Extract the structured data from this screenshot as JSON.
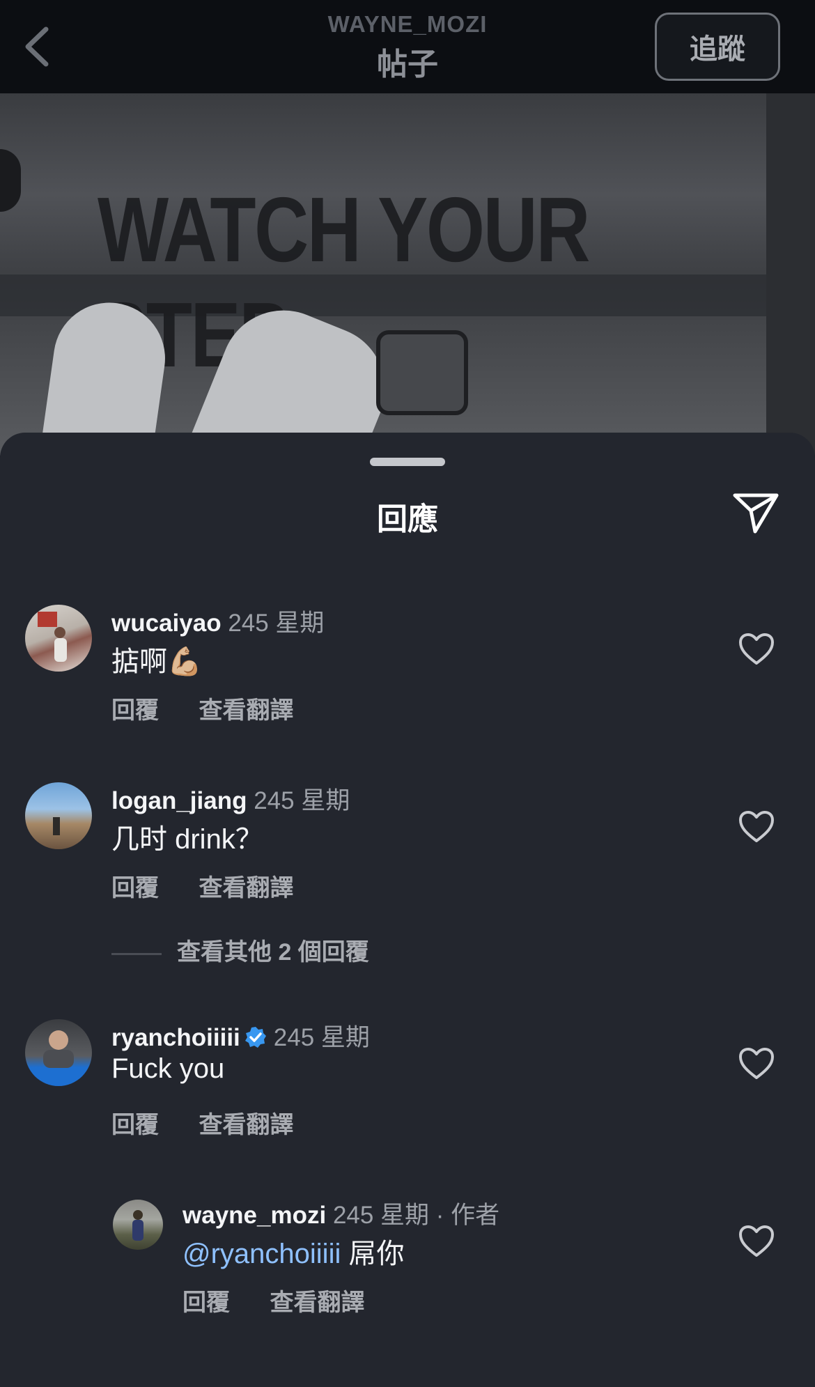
{
  "header": {
    "subtitle": "WAYNE_MOZI",
    "title": "帖子",
    "follow_label": "追蹤"
  },
  "photo": {
    "sign_text": "WATCH YOUR STEP"
  },
  "sheet": {
    "title": "回應"
  },
  "comments": [
    {
      "username": "wucaiyao",
      "time": "245 星期",
      "text": "掂啊💪🏼",
      "reply": "回覆",
      "translate": "查看翻譯"
    },
    {
      "username": "logan_jiang",
      "time": "245 星期",
      "text": "几时 drink？",
      "reply": "回覆",
      "translate": "查看翻譯",
      "view_more": "查看其他 2 個回覆"
    },
    {
      "username": "ryanchoiiiii",
      "verified": true,
      "time": "245 星期",
      "text": "Fuck you",
      "reply": "回覆",
      "translate": "查看翻譯"
    },
    {
      "username": "wayne_mozi",
      "time": "245 星期 · 作者",
      "mention": "@ryanchoiiiii",
      "text": " 屌你",
      "reply": "回覆",
      "translate": "查看翻譯"
    }
  ],
  "colors": {
    "sheet_bg": "#23262e",
    "mention": "#8fc1ff",
    "verified": "#3897f0"
  }
}
